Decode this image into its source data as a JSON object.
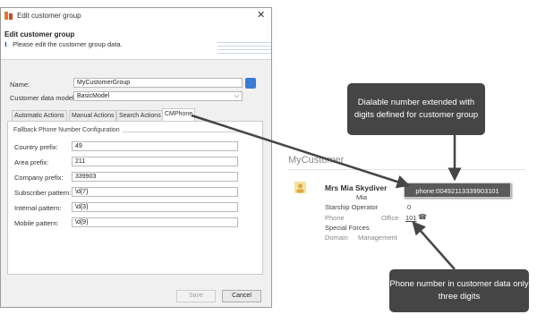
{
  "window": {
    "title": "Edit customer group",
    "close_glyph": "✕",
    "header_title": "Edit customer group",
    "header_info": "Please edit the customer group data.",
    "info_icon": "i"
  },
  "form": {
    "name_label": "Name:",
    "name_value": "MyCustomerGroup",
    "model_label": "Customer data model:",
    "model_value": "BasicModel",
    "dropdown_glyph": "⌵"
  },
  "tabs": [
    {
      "label": "Automatic Actions"
    },
    {
      "label": "Manual Actions"
    },
    {
      "label": "Search Actions"
    },
    {
      "label": "CMPhone"
    }
  ],
  "cmphone": {
    "group_title": "Fallback Phone Number Configuration",
    "fields": [
      {
        "label": "Country prefix:",
        "value": "49"
      },
      {
        "label": "Area prefix:",
        "value": "211"
      },
      {
        "label": "Company prefix:",
        "value": "339903"
      },
      {
        "label": "Subscriber pattern:",
        "value": "\\d{7}"
      },
      {
        "label": "Internal pattern:",
        "value": "\\d{3}"
      },
      {
        "label": "Mobile pattern:",
        "value": "\\d{9}"
      }
    ]
  },
  "buttons": {
    "save": "Save",
    "cancel": "Cancel"
  },
  "customer": {
    "heading": "MyCustomer",
    "name": "Mrs Mia Skydiver",
    "first_name": "Mia",
    "job": "Starship Operator",
    "job_value": "0",
    "phone_label": "Phone",
    "office_label": "Office",
    "phone_number": "101",
    "phone_icon": "☎",
    "department": "Special Forces",
    "domain_label": "Domain",
    "domain_value": "Management",
    "tooltip": "phone:00492113339903101"
  },
  "callouts": {
    "top": "Dialable number extended with digits defined for customer group",
    "bottom": "Phone number in customer data only three digits"
  },
  "colors": {
    "accent": "#3a7bd5",
    "callout_bg": "#454545",
    "tooltip_bg": "#5a5a5a"
  }
}
